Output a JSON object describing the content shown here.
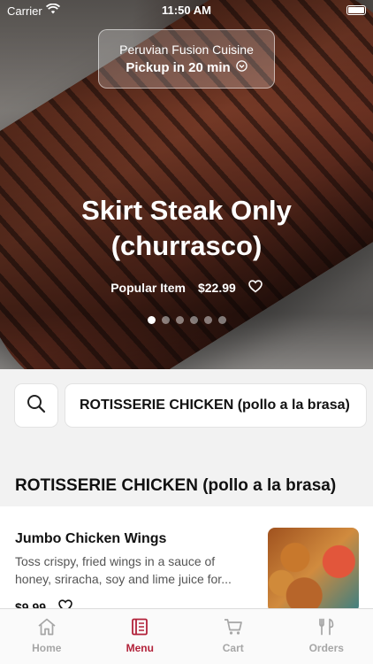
{
  "status_bar": {
    "carrier": "Carrier",
    "time": "11:50 AM"
  },
  "hero": {
    "restaurant_name": "Peruvian Fusion Cuisine",
    "pickup": "Pickup in 20 min",
    "title": "Skirt Steak Only (churrasco)",
    "badge": "Popular Item",
    "price": "$22.99",
    "carousel_count": 6,
    "carousel_active_index": 0
  },
  "search": {
    "category": "ROTISSERIE CHICKEN (pollo a la brasa)"
  },
  "section": {
    "title": "ROTISSERIE CHICKEN (pollo a la brasa)"
  },
  "items": [
    {
      "name": "Jumbo Chicken Wings",
      "description": "Toss crispy, fried wings in a sauce of honey, sriracha, soy and lime juice for...",
      "price": "$9.99"
    }
  ],
  "tabs": [
    {
      "label": "Home",
      "icon": "home-icon",
      "active": false
    },
    {
      "label": "Menu",
      "icon": "menu-icon",
      "active": true
    },
    {
      "label": "Cart",
      "icon": "cart-icon",
      "active": false
    },
    {
      "label": "Orders",
      "icon": "orders-icon",
      "active": false
    }
  ],
  "colors": {
    "accent": "#b2223a",
    "inactive_tab": "#a6a6a6"
  }
}
